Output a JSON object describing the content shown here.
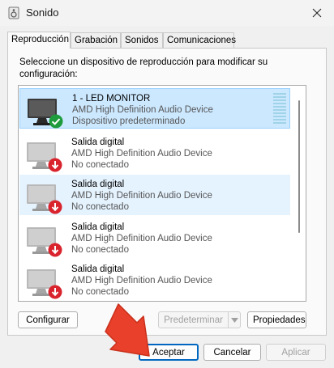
{
  "window": {
    "title": "Sonido",
    "icon": "speaker-app-icon",
    "close_icon": "close-icon"
  },
  "tabs": [
    {
      "label": "Reproducción",
      "active": true
    },
    {
      "label": "Grabación",
      "active": false
    },
    {
      "label": "Sonidos",
      "active": false
    },
    {
      "label": "Comunicaciones",
      "active": false
    }
  ],
  "instruction": "Seleccione un dispositivo de reproducción para modificar su configuración:",
  "devices": [
    {
      "name": "1 - LED MONITOR",
      "description": "AMD High Definition Audio Device",
      "status": "Dispositivo predeterminado",
      "badge": "green-check-icon",
      "selected": true
    },
    {
      "name": "Salida digital",
      "description": "AMD High Definition Audio Device",
      "status": "No conectado",
      "badge": "red-down-arrow-icon",
      "selected": false
    },
    {
      "name": "Salida digital",
      "description": "AMD High Definition Audio Device",
      "status": "No conectado",
      "badge": "red-down-arrow-icon",
      "selected": false
    },
    {
      "name": "Salida digital",
      "description": "AMD High Definition Audio Device",
      "status": "No conectado",
      "badge": "red-down-arrow-icon",
      "selected": false
    },
    {
      "name": "Salida digital",
      "description": "AMD High Definition Audio Device",
      "status": "No conectado",
      "badge": "red-down-arrow-icon",
      "selected": false
    }
  ],
  "buttons": {
    "configure": "Configurar",
    "set_default": "Predeterminar",
    "properties": "Propiedades",
    "accept": "Aceptar",
    "cancel": "Cancelar",
    "apply": "Aplicar"
  },
  "colors": {
    "selection_bg": "#cce8ff",
    "hover_bg": "#e5f3ff",
    "accent": "#0067c0",
    "status_ok": "#1e9b3c",
    "status_bad": "#d9232d",
    "annotation_arrow": "#e8402a"
  }
}
